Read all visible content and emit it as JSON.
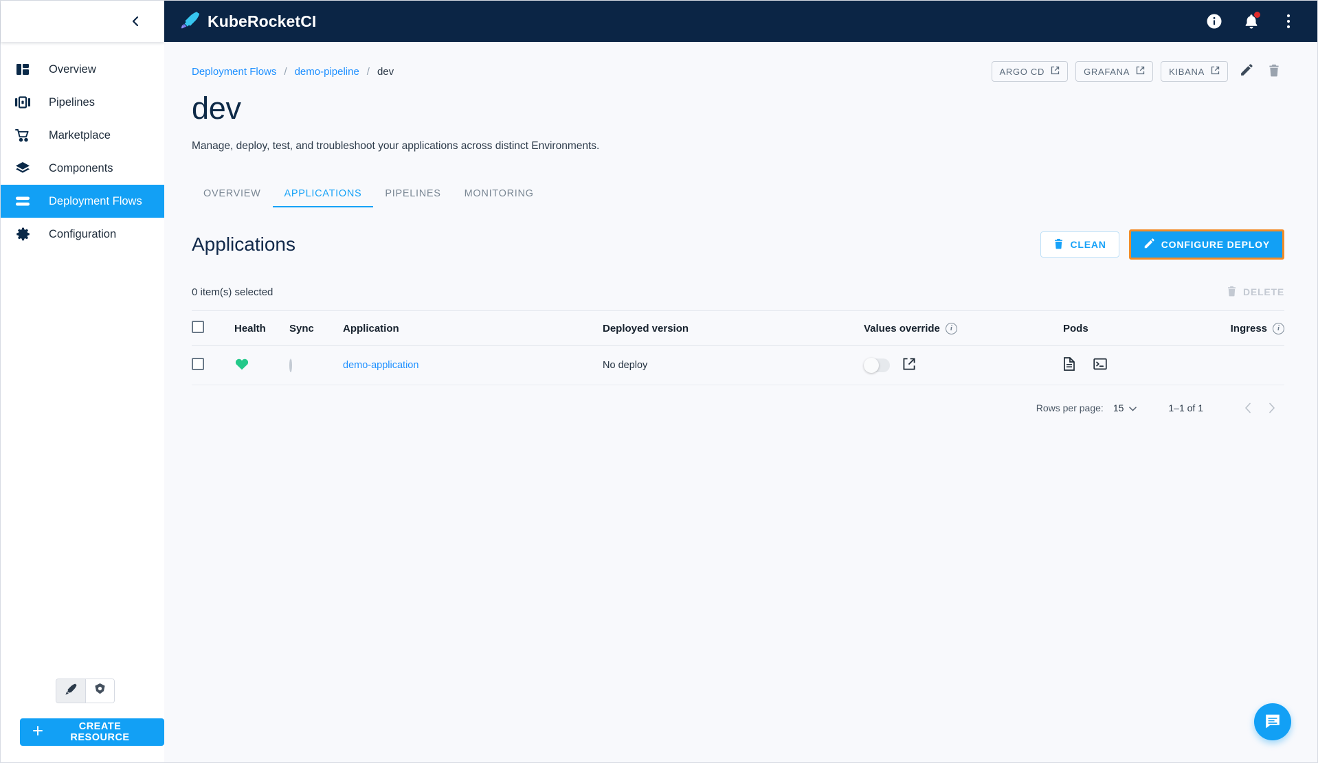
{
  "sidebar": {
    "collapse_icon": "chevron-left-icon",
    "items": [
      {
        "label": "Overview",
        "icon": "dashboard-icon",
        "active": false
      },
      {
        "label": "Pipelines",
        "icon": "pipelines-icon",
        "active": false
      },
      {
        "label": "Marketplace",
        "icon": "cart-icon",
        "active": false
      },
      {
        "label": "Components",
        "icon": "layers-icon",
        "active": false
      },
      {
        "label": "Deployment Flows",
        "icon": "flows-icon",
        "active": true
      },
      {
        "label": "Configuration",
        "icon": "gear-icon",
        "active": false
      }
    ],
    "view_toggle": [
      {
        "icon": "krci-rocket-icon",
        "selected": true
      },
      {
        "icon": "kubernetes-icon",
        "selected": false
      }
    ],
    "create_resource_label": "CREATE RESOURCE",
    "create_resource_icon": "plus-icon"
  },
  "topbar": {
    "brand": "KubeRocketCI",
    "brand_icon": "kuberocket-logo-icon",
    "background": "#0b2545",
    "actions": [
      {
        "icon": "info-icon",
        "badge": false
      },
      {
        "icon": "bell-icon",
        "badge": true
      },
      {
        "icon": "more-vertical-icon",
        "badge": false
      }
    ],
    "badge_color": "#e02b2b"
  },
  "breadcrumb": {
    "items": [
      {
        "label": "Deployment Flows",
        "link": true
      },
      {
        "label": "demo-pipeline",
        "link": true
      },
      {
        "label": "dev",
        "link": false
      }
    ],
    "separator": "/"
  },
  "header_actions": {
    "links": [
      {
        "label": "ARGO CD",
        "icon": "external-link-icon"
      },
      {
        "label": "GRAFANA",
        "icon": "external-link-icon"
      },
      {
        "label": "KIBANA",
        "icon": "external-link-icon"
      }
    ],
    "edit_icon": "pencil-icon",
    "delete_icon": "trash-icon"
  },
  "page": {
    "title": "dev",
    "description": "Manage, deploy, test, and troubleshoot your applications across distinct Environments."
  },
  "tabs": [
    {
      "label": "OVERVIEW",
      "active": false
    },
    {
      "label": "APPLICATIONS",
      "active": true
    },
    {
      "label": "PIPELINES",
      "active": false
    },
    {
      "label": "MONITORING",
      "active": false
    }
  ],
  "section": {
    "title": "Applications",
    "clean_label": "CLEAN",
    "clean_icon": "trash-icon",
    "configure_label": "CONFIGURE DEPLOY",
    "configure_icon": "pencil-icon",
    "configure_highlight_color": "#f28c28",
    "accent_color": "#12a0f5"
  },
  "selection": {
    "count_text": "0 item(s) selected",
    "delete_label": "DELETE",
    "delete_icon": "trash-icon"
  },
  "table": {
    "columns": [
      {
        "key": "check",
        "label": "",
        "icon": "checkbox-icon"
      },
      {
        "key": "health",
        "label": "Health"
      },
      {
        "key": "sync",
        "label": "Sync"
      },
      {
        "key": "application",
        "label": "Application"
      },
      {
        "key": "deployed_version",
        "label": "Deployed version"
      },
      {
        "key": "values_override",
        "label": "Values override",
        "info": true
      },
      {
        "key": "pods",
        "label": "Pods"
      },
      {
        "key": "ingress",
        "label": "Ingress",
        "info": true
      }
    ],
    "rows": [
      {
        "selected": false,
        "health": "healthy",
        "health_icon": "heart-icon",
        "health_color": "#24c98a",
        "sync": "unknown",
        "sync_icon": "ring-icon",
        "application": "demo-application",
        "deployed_version": "No deploy",
        "values_override": false,
        "values_override_link_icon": "external-link-icon",
        "pods_icons": [
          "document-icon",
          "terminal-icon"
        ],
        "ingress": ""
      }
    ]
  },
  "pagination": {
    "rows_per_page_label": "Rows per page:",
    "rows_per_page_value": "15",
    "range": "1–1 of 1",
    "prev_icon": "chevron-left-icon",
    "next_icon": "chevron-right-icon"
  },
  "fab": {
    "icon": "chat-icon",
    "color": "#12a0f5"
  }
}
